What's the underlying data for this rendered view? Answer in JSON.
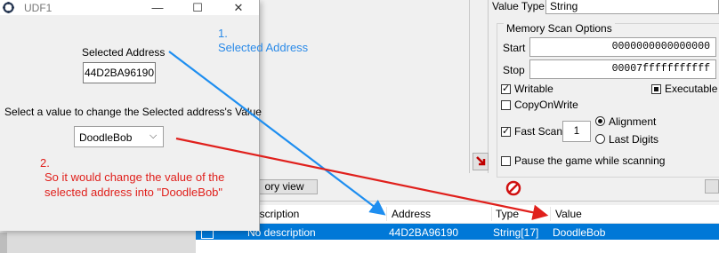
{
  "dialog": {
    "title": "UDF1",
    "selected_address_label": "Selected Address",
    "selected_address_value": "44D2BA96190",
    "instruction": "Select a value to change the Selected address's Value",
    "combo_value": "DoodleBob"
  },
  "cheat_engine": {
    "value_type_label": "Value Type",
    "value_type_value": "String",
    "memory_scan_options": "Memory Scan Options",
    "start_label": "Start",
    "start_value": "0000000000000000",
    "stop_label": "Stop",
    "stop_value": "00007fffffffffff",
    "writable": "Writable",
    "executable": "Executable",
    "copy_on_write": "CopyOnWrite",
    "fast_scan": "Fast Scan",
    "fast_scan_value": "1",
    "alignment": "Alignment",
    "last_digits": "Last Digits",
    "pause_game": "Pause the game while scanning",
    "memory_view_button": "ory view",
    "table": {
      "headers": [
        "escription",
        "Address",
        "Type",
        "Value"
      ],
      "row": [
        "No description",
        "44D2BA96190",
        "String[17]",
        "DoodleBob"
      ]
    }
  },
  "annotations": {
    "blue_number": "1.",
    "blue_text": "Selected Address",
    "red_number": "2.",
    "red_text_line1": "So it would change the value of the",
    "red_text_line2": "selected address into \"DoodleBob\""
  },
  "colors": {
    "selection": "#0078d7",
    "annotation_blue": "#1e8ef0",
    "annotation_red": "#e0201c"
  }
}
